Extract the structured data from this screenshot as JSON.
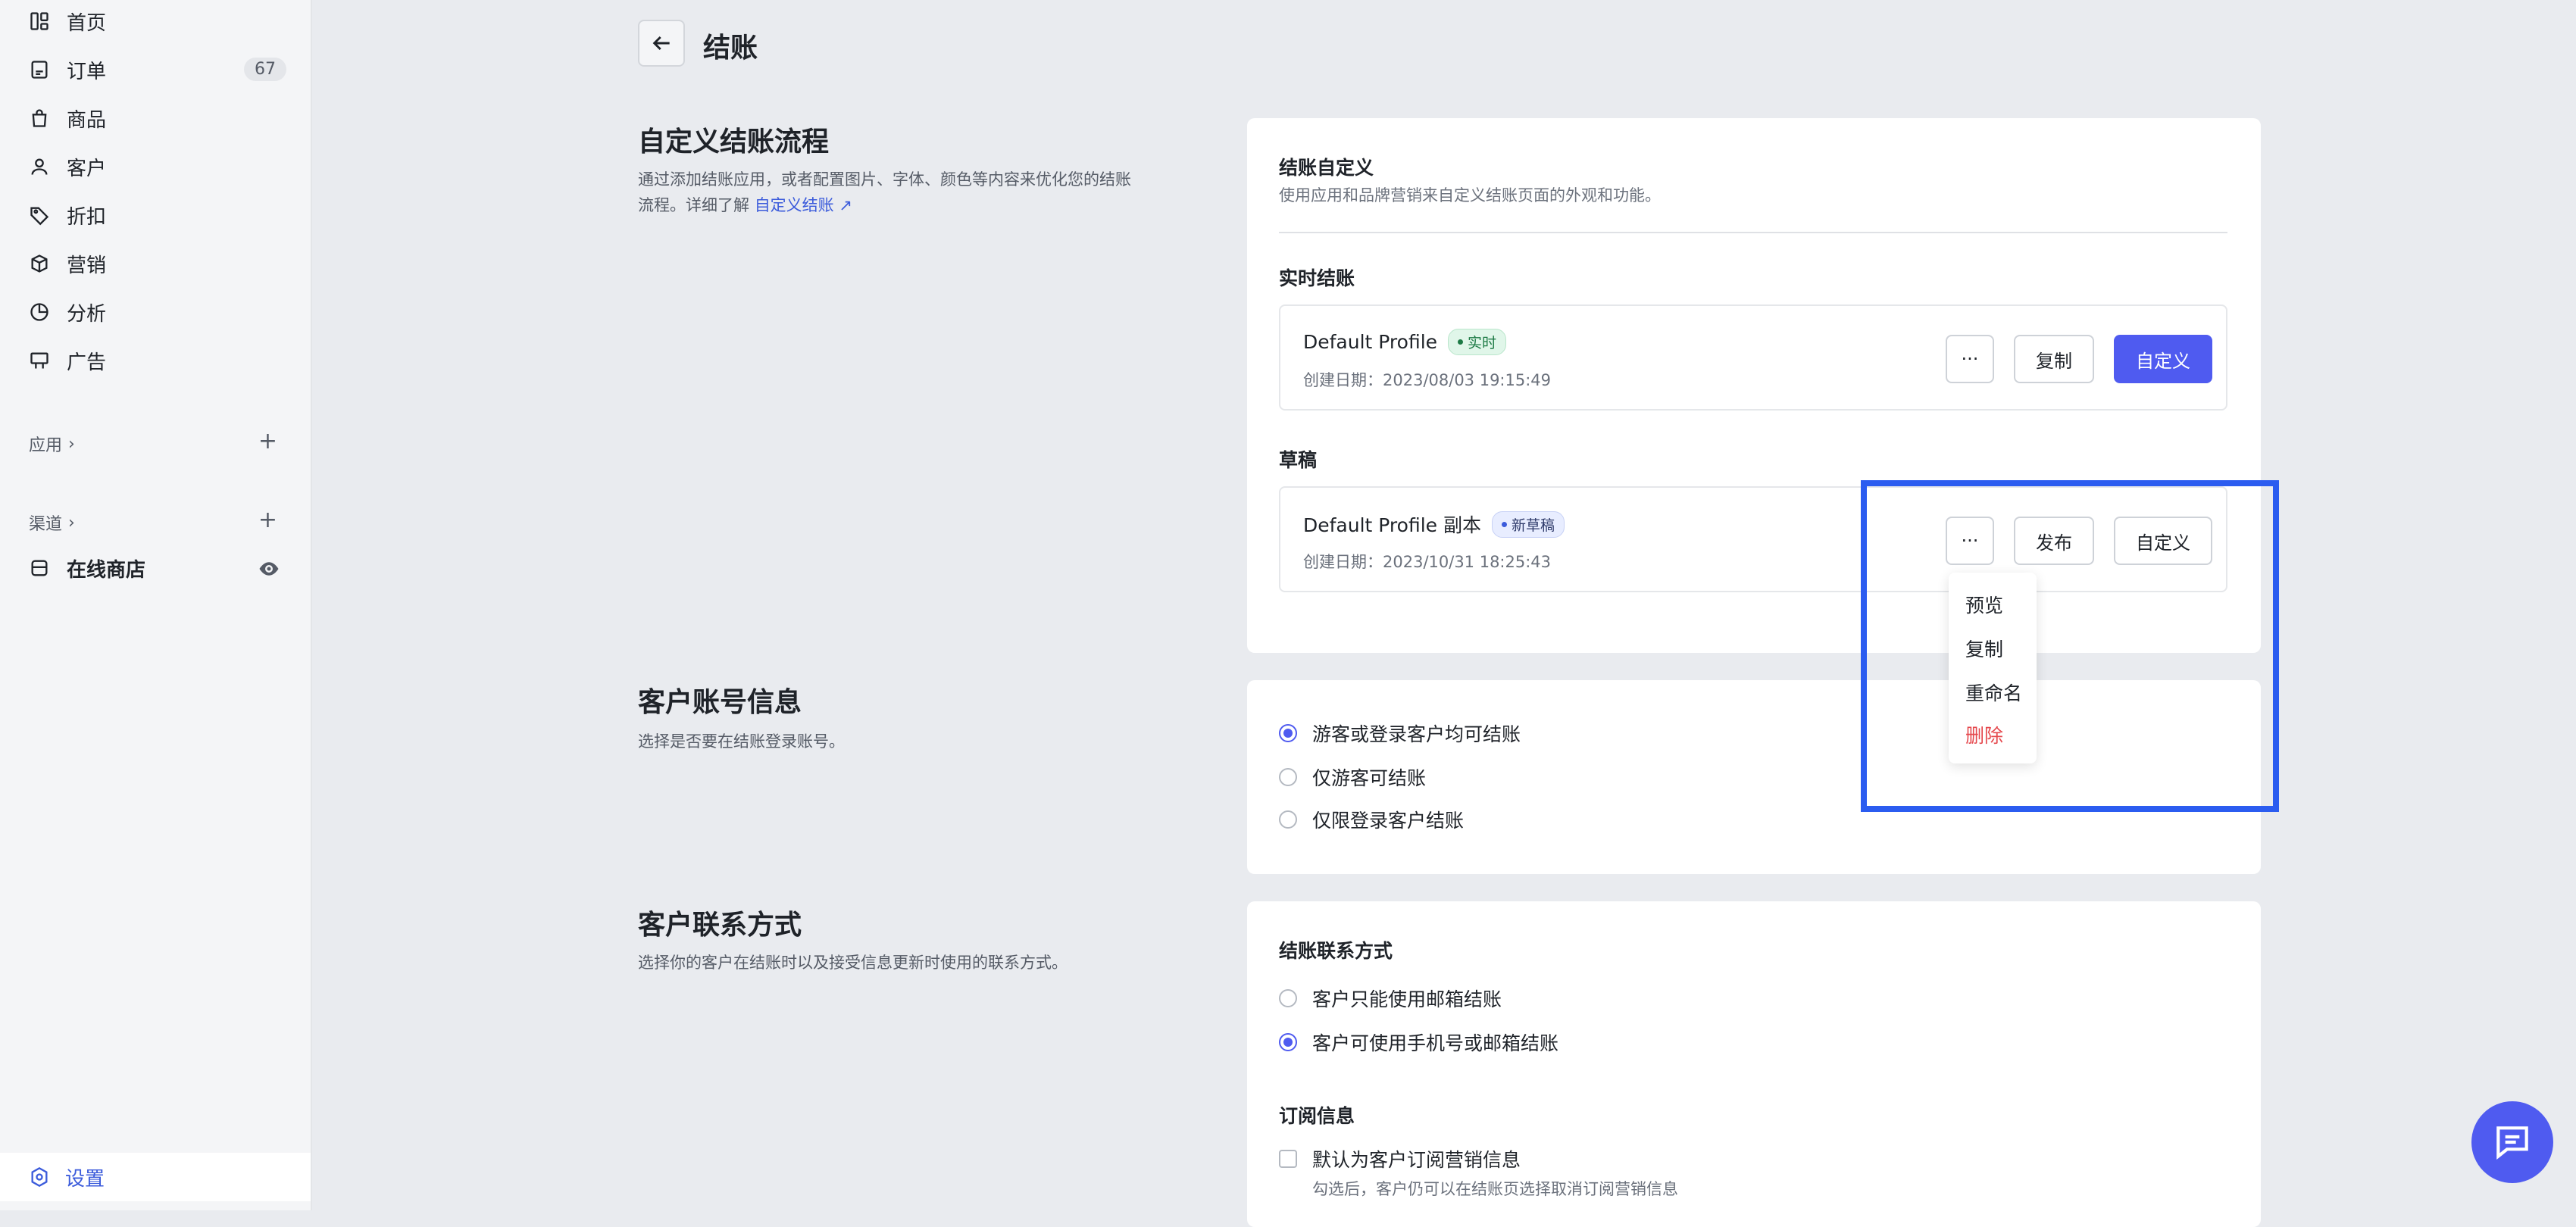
{
  "sidebar": {
    "items": [
      {
        "label": "首页",
        "icon": "home-grid-icon"
      },
      {
        "label": "订单",
        "icon": "order-icon",
        "badge": "67"
      },
      {
        "label": "商品",
        "icon": "bag-icon"
      },
      {
        "label": "客户",
        "icon": "user-icon"
      },
      {
        "label": "折扣",
        "icon": "tag-icon"
      },
      {
        "label": "营销",
        "icon": "box-icon"
      },
      {
        "label": "分析",
        "icon": "pie-icon"
      },
      {
        "label": "广告",
        "icon": "billboard-icon"
      }
    ],
    "apps_label": "应用",
    "channels_label": "渠道",
    "online_store": "在线商店",
    "settings": "设置"
  },
  "header": {
    "title": "结账"
  },
  "checkout_section": {
    "title": "自定义结账流程",
    "desc_line1": "通过添加结账应用，或者配置图片、字体、颜色等内容来优化您的结账",
    "desc_line2": "流程。详细了解",
    "link": "自定义结账"
  },
  "card1": {
    "title": "结账自定义",
    "subtitle": "使用应用和品牌营销来自定义结账页面的外观和功能。",
    "live_label": "实时结账",
    "live_profile": {
      "name": "Default Profile",
      "tag": "实时",
      "date": "创建日期：2023/08/03 19:15:49"
    },
    "draft_label": "草稿",
    "draft_profile": {
      "name": "Default Profile 副本",
      "tag": "新草稿",
      "date": "创建日期：2023/10/31 18:25:43"
    },
    "more_label": "···",
    "copy_label": "复制",
    "customize_label": "自定义",
    "publish_label": "发布"
  },
  "dropdown": {
    "items": [
      "预览",
      "复制",
      "重命名",
      "删除"
    ]
  },
  "account_section": {
    "title": "客户账号信息",
    "desc": "选择是否要在结账登录账号。",
    "options": [
      "游客或登录客户均可结账",
      "仅游客可结账",
      "仅限登录客户结账"
    ],
    "selected": 0
  },
  "contact_section": {
    "title": "客户联系方式",
    "desc": "选择你的客户在结账时以及接受信息更新时使用的联系方式。",
    "card_title": "结账联系方式",
    "options": [
      "客户只能使用邮箱结账",
      "客户可使用手机号或邮箱结账"
    ],
    "selected": 1,
    "subscribe_title": "订阅信息",
    "subscribe_checkbox": "默认为客户订阅营销信息",
    "subscribe_hint": "勾选后，客户仍可以在结账页选择取消订阅营销信息"
  },
  "colors": {
    "accent": "#4f5bf0",
    "danger": "#e5484d",
    "highlight": "#2b5cf0",
    "live_tag": "#1d7a45"
  }
}
